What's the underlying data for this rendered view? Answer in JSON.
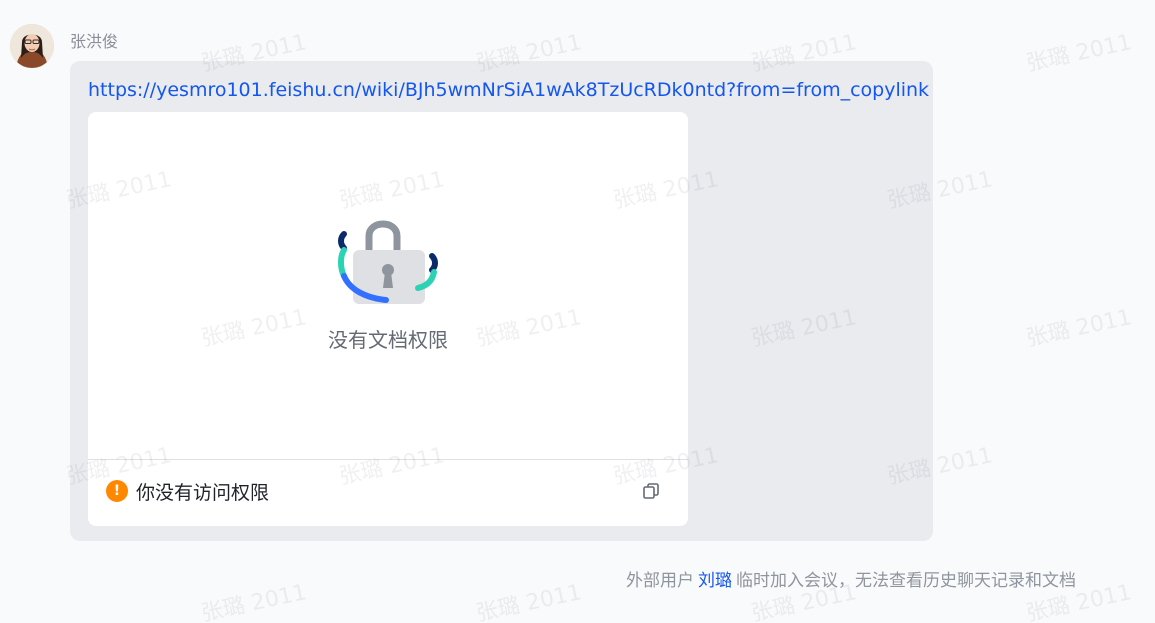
{
  "message": {
    "sender_name": "张洪俊",
    "link_text": "https://yesmro101.feishu.cn/wiki/BJh5wmNrSiA1wAk8TzUcRDk0ntd?from=from_copylink",
    "card": {
      "title": "没有文档权限",
      "footer_text": "你没有访问权限",
      "warning_glyph": "!",
      "lock_icon": "lock-icon",
      "copy_icon": "copy-icon"
    }
  },
  "system_notice": {
    "prefix": "外部用户",
    "user": "刘璐",
    "suffix": "临时加入会议，无法查看历史聊天记录和文档"
  },
  "watermark": {
    "text": "张璐 2011"
  },
  "colors": {
    "link": "#1456f0",
    "warning": "#ff8800",
    "bubble_bg": "#e9ebee",
    "card_bg": "#ffffff"
  }
}
